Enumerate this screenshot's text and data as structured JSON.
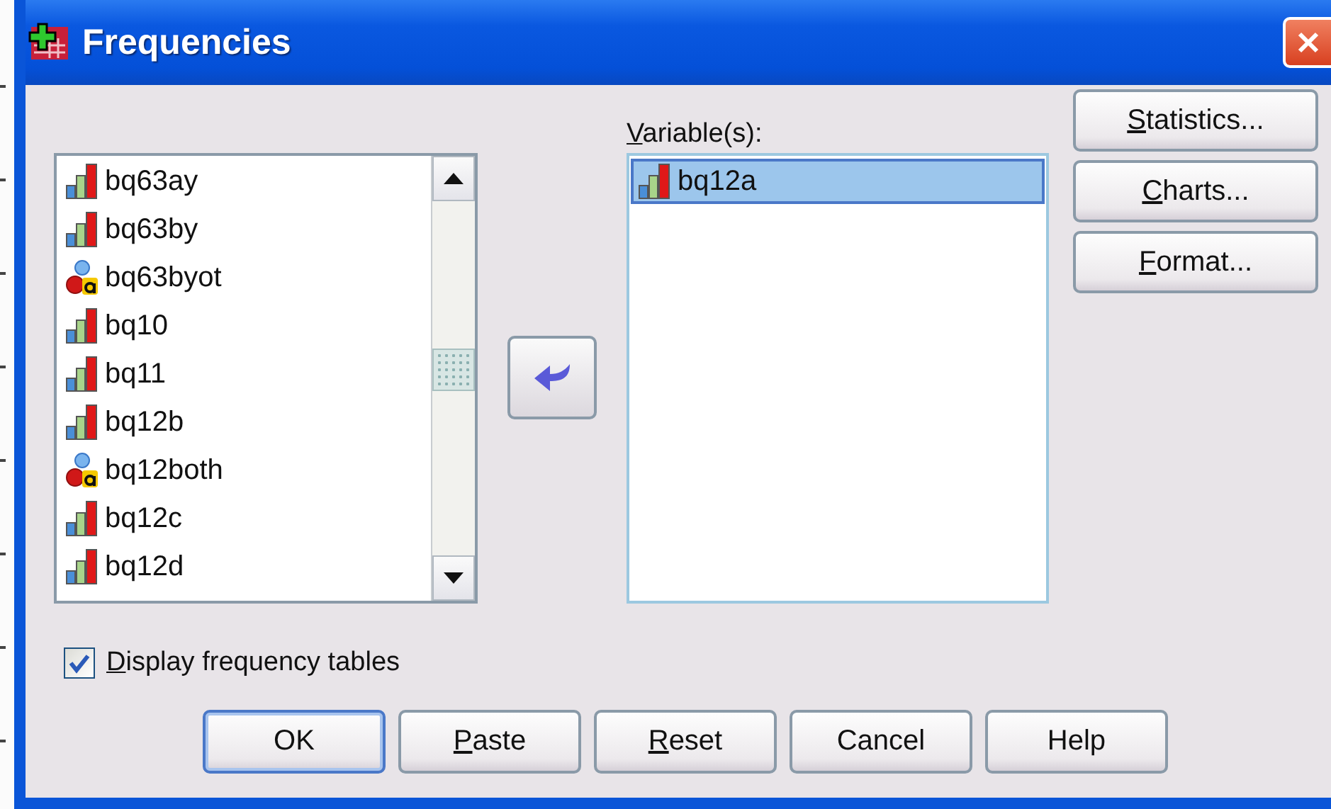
{
  "window": {
    "title": "Frequencies"
  },
  "source_list": {
    "items": [
      {
        "name": "bq63ay",
        "kind": "scale",
        "selected": false
      },
      {
        "name": "bq63by",
        "kind": "scale",
        "selected": false
      },
      {
        "name": "bq63byot",
        "kind": "nominal",
        "selected": false
      },
      {
        "name": "bq10",
        "kind": "scale",
        "selected": false
      },
      {
        "name": "bq11",
        "kind": "scale",
        "selected": false
      },
      {
        "name": "bq12b",
        "kind": "scale",
        "selected": false
      },
      {
        "name": "bq12both",
        "kind": "nominal",
        "selected": false
      },
      {
        "name": "bq12c",
        "kind": "scale",
        "selected": false
      },
      {
        "name": "bq12d",
        "kind": "scale",
        "selected": false
      }
    ]
  },
  "target": {
    "label": "Variable(s):",
    "underline_first": true,
    "items": [
      {
        "name": "bq12a",
        "kind": "scale",
        "selected": true
      }
    ]
  },
  "side_buttons": [
    {
      "label": "Statistics...",
      "underline_first": true
    },
    {
      "label": "Charts...",
      "underline_first": true
    },
    {
      "label": "Format...",
      "underline_first": true
    }
  ],
  "checkbox": {
    "label": "Display frequency tables",
    "underline_first": true,
    "checked": true
  },
  "buttons": [
    {
      "label": "OK",
      "underline_first": false,
      "default": true
    },
    {
      "label": "Paste",
      "underline_first": true,
      "default": false
    },
    {
      "label": "Reset",
      "underline_first": true,
      "default": false
    },
    {
      "label": "Cancel",
      "underline_first": false,
      "default": false
    },
    {
      "label": "Help",
      "underline_first": false,
      "default": false
    }
  ]
}
